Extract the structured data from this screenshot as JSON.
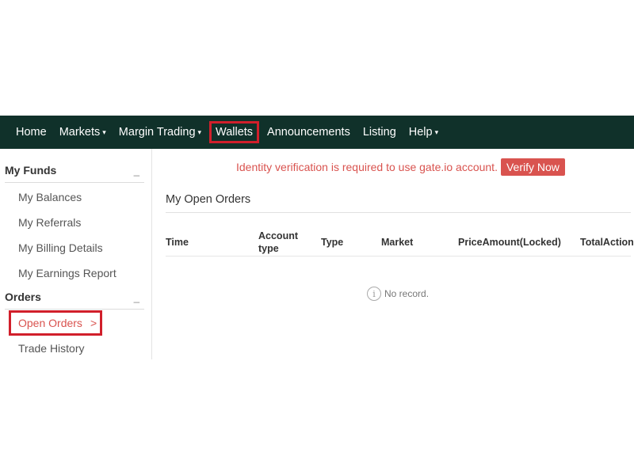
{
  "nav": {
    "items": [
      {
        "label": "Home",
        "caret": false
      },
      {
        "label": "Markets",
        "caret": true
      },
      {
        "label": "Margin Trading",
        "caret": true
      },
      {
        "label": "Wallets",
        "caret": false,
        "highlighted": true
      },
      {
        "label": "Announcements",
        "caret": false
      },
      {
        "label": "Listing",
        "caret": false
      },
      {
        "label": "Help",
        "caret": true
      }
    ],
    "caret_glyph": "▾"
  },
  "sidebar": {
    "funds_header": "My Funds",
    "collapse_glyph": "_",
    "funds_items": [
      "My Balances",
      "My Referrals",
      "My Billing Details",
      "My Earnings Report"
    ],
    "orders_header": "Orders",
    "orders_items": [
      {
        "label": "Open Orders",
        "arrow": ">",
        "active": true
      },
      {
        "label": "Trade History",
        "active": false
      }
    ]
  },
  "main": {
    "notice_text": "Identity verification  is required to use gate.io account.",
    "verify_label": "Verify Now",
    "section_title": "My Open Orders",
    "columns": [
      "Time",
      "Account type",
      "Type",
      "Market",
      "PriceAmount(Locked)",
      "TotalAction"
    ],
    "empty_icon": "i",
    "empty_text": "No record."
  },
  "colors": {
    "navbar_bg": "#10312a",
    "highlight_border": "#d11f2b",
    "notice_red": "#d9534f"
  }
}
